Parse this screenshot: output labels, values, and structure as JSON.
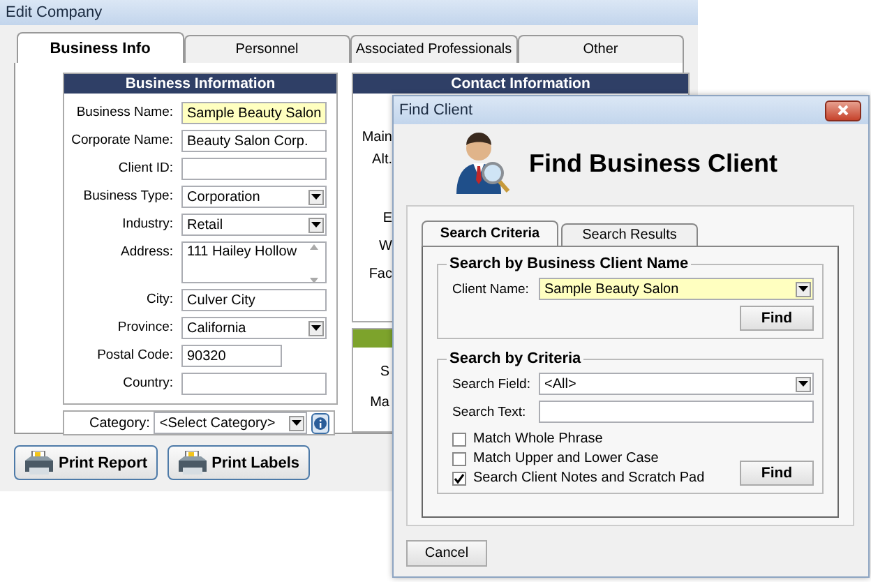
{
  "edit_company": {
    "title": "Edit Company",
    "tabs": [
      {
        "label": "Business Info",
        "selected": true
      },
      {
        "label": "Personnel",
        "selected": false
      },
      {
        "label": "Associated Professionals",
        "selected": false
      },
      {
        "label": "Other",
        "selected": false
      }
    ],
    "business_info": {
      "title": "Business Information",
      "fields": [
        {
          "label": "Business Name:",
          "kind": "text",
          "value": "Sample Beauty Salon",
          "focused": true
        },
        {
          "label": "Corporate Name:",
          "kind": "text",
          "value": "Beauty Salon Corp.",
          "focused": false
        },
        {
          "label": "Client ID:",
          "kind": "text",
          "focused": false
        },
        {
          "label": "Business Type:",
          "kind": "combo",
          "value": "Corporation",
          "focused": false
        },
        {
          "label": "Industry:",
          "kind": "combo",
          "value": "Retail",
          "focused": false
        },
        {
          "label": "Address:",
          "kind": "textarea",
          "value": "111 Hailey Hollow",
          "focused": false
        },
        {
          "label": "City:",
          "kind": "text",
          "value": "Culver City",
          "focused": false
        },
        {
          "label": "Province:",
          "kind": "combo",
          "value": "California",
          "focused": false
        },
        {
          "label": "Postal Code:",
          "kind": "short",
          "value": "90320",
          "focused": false
        },
        {
          "label": "Country:",
          "kind": "text",
          "focused": false
        }
      ]
    },
    "category": {
      "label": "Category:",
      "value": "<Select Category>"
    },
    "contact_info": {
      "title": "Contact Information",
      "labels": [
        "Main",
        "Alt.",
        "E",
        "W",
        "Fac"
      ]
    },
    "second_panel": {
      "labels": [
        "S",
        "Ma"
      ]
    },
    "buttons": [
      "Print Report",
      "Print Labels"
    ]
  },
  "find_client": {
    "title": "Find Client",
    "heading": "Find Business Client",
    "tabs": [
      {
        "label": "Search Criteria",
        "selected": true
      },
      {
        "label": "Search Results",
        "selected": false
      }
    ],
    "name_group": {
      "title": "Search by Business Client Name",
      "label": "Client Name:",
      "value": "Sample Beauty Salon",
      "focused": true,
      "find": "Find"
    },
    "criteria_group": {
      "title": "Search by Criteria",
      "field_label": "Search Field:",
      "field_value": "<All>",
      "text_label": "Search Text:",
      "options": [
        {
          "label": "Match Whole Phrase",
          "checked": false
        },
        {
          "label": "Match Upper and Lower Case",
          "checked": false
        },
        {
          "label": "Search Client Notes and Scratch Pad",
          "checked": true
        }
      ],
      "find": "Find"
    },
    "cancel": "Cancel"
  }
}
